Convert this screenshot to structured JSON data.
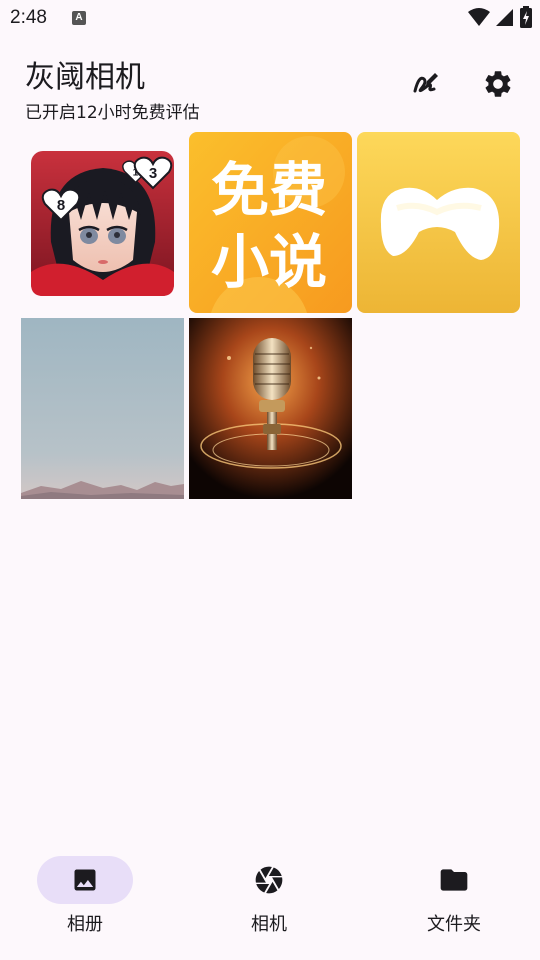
{
  "status_bar": {
    "time": "2:48",
    "notification_badge": "A",
    "icons": [
      "wifi-icon",
      "cellular-icon",
      "battery-charging-icon"
    ]
  },
  "header": {
    "title": "灰阈相机",
    "subtitle": "已开启12小时免费评估",
    "actions": [
      {
        "name": "edit-icon"
      },
      {
        "name": "settings-icon"
      }
    ]
  },
  "gallery": {
    "items": [
      {
        "name": "anime-girl-app-icon",
        "text": [
          "8",
          "1",
          "3"
        ]
      },
      {
        "name": "free-novel-app-icon",
        "text": [
          "免费",
          "小说"
        ]
      },
      {
        "name": "game-controller-app-icon"
      },
      {
        "name": "sky-landscape-photo"
      },
      {
        "name": "microphone-photo"
      }
    ]
  },
  "bottom_nav": {
    "items": [
      {
        "label": "相册",
        "icon": "photo-icon",
        "active": true
      },
      {
        "label": "相机",
        "icon": "aperture-icon",
        "active": false
      },
      {
        "label": "文件夹",
        "icon": "folder-icon",
        "active": false
      }
    ]
  },
  "colors": {
    "background": "#fdf8fc",
    "active_pill": "#e8def8",
    "icon": "#1c1b1f",
    "novel_orange": "#f9a826",
    "controller_yellow": "#f2bd3c"
  }
}
